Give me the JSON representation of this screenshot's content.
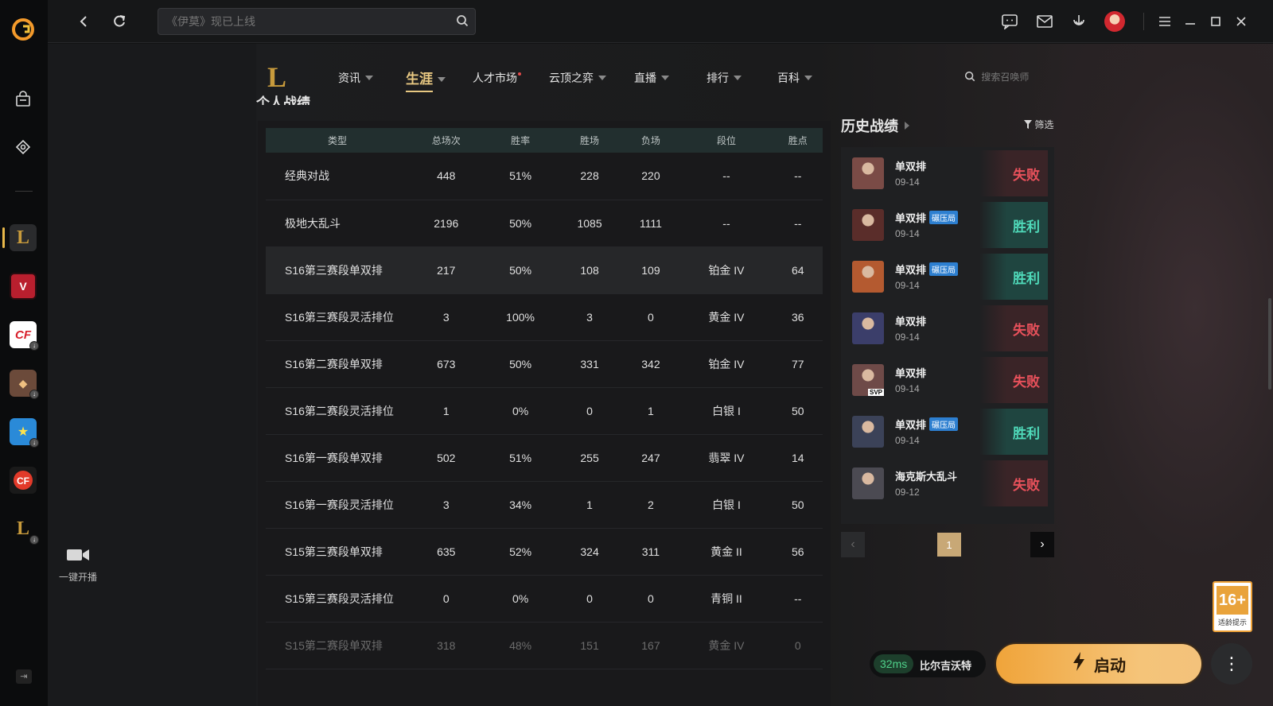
{
  "topbar": {
    "search_placeholder": "《伊莫》现已上线"
  },
  "sidebar": {
    "live_label": "一键开播"
  },
  "nav": {
    "items": [
      {
        "label": "资讯"
      },
      {
        "label": "生涯"
      },
      {
        "label": "人才市场"
      },
      {
        "label": "云顶之弈"
      },
      {
        "label": "直播"
      },
      {
        "label": "排行"
      },
      {
        "label": "百科"
      }
    ],
    "active_index": 1,
    "search_placeholder": "搜索召唤师"
  },
  "section": {
    "title": "个人战绩"
  },
  "table": {
    "headers": [
      "类型",
      "总场次",
      "胜率",
      "胜场",
      "负场",
      "段位",
      "胜点"
    ],
    "rows": [
      [
        "经典对战",
        "448",
        "51%",
        "228",
        "220",
        "--",
        "--"
      ],
      [
        "极地大乱斗",
        "2196",
        "50%",
        "1085",
        "1111",
        "--",
        "--"
      ],
      [
        "S16第三赛段单双排",
        "217",
        "50%",
        "108",
        "109",
        "铂金 IV",
        "64"
      ],
      [
        "S16第三赛段灵活排位",
        "3",
        "100%",
        "3",
        "0",
        "黄金 IV",
        "36"
      ],
      [
        "S16第二赛段单双排",
        "673",
        "50%",
        "331",
        "342",
        "铂金 IV",
        "77"
      ],
      [
        "S16第二赛段灵活排位",
        "1",
        "0%",
        "0",
        "1",
        "白银 I",
        "50"
      ],
      [
        "S16第一赛段单双排",
        "502",
        "51%",
        "255",
        "247",
        "翡翠 IV",
        "14"
      ],
      [
        "S16第一赛段灵活排位",
        "3",
        "34%",
        "1",
        "2",
        "白银 I",
        "50"
      ],
      [
        "S15第三赛段单双排",
        "635",
        "52%",
        "324",
        "311",
        "黄金 II",
        "56"
      ],
      [
        "S15第三赛段灵活排位",
        "0",
        "0%",
        "0",
        "0",
        "青铜 II",
        "--"
      ],
      [
        "S15第二赛段单双排",
        "318",
        "48%",
        "151",
        "167",
        "黄金 IV",
        "0"
      ]
    ]
  },
  "history": {
    "title": "历史战绩",
    "filter_label": "筛选",
    "matches": [
      {
        "mode": "单双排",
        "tag": "",
        "date": "09-14",
        "result": "失败",
        "win": false,
        "color": "#7a4b46"
      },
      {
        "mode": "单双排",
        "tag": "碾压局",
        "date": "09-14",
        "result": "胜利",
        "win": true,
        "color": "#5a2d2a"
      },
      {
        "mode": "单双排",
        "tag": "碾压局",
        "date": "09-14",
        "result": "胜利",
        "win": true,
        "color": "#b45a30"
      },
      {
        "mode": "单双排",
        "tag": "",
        "date": "09-14",
        "result": "失败",
        "win": false,
        "color": "#3b3e6a"
      },
      {
        "mode": "单双排",
        "tag": "",
        "date": "09-14",
        "result": "失败",
        "win": false,
        "color": "#6e4a48",
        "svp": "SVP"
      },
      {
        "mode": "单双排",
        "tag": "碾压局",
        "date": "09-14",
        "result": "胜利",
        "win": true,
        "color": "#3b4258"
      },
      {
        "mode": "海克斯大乱斗",
        "tag": "",
        "date": "09-12",
        "result": "失败",
        "win": false,
        "color": "#4b4a52"
      }
    ],
    "page": "1"
  },
  "footer": {
    "ping": "32ms",
    "server": "比尔吉沃特",
    "launch_label": "启动",
    "age_rating": "16+",
    "age_note": "适龄提示"
  }
}
